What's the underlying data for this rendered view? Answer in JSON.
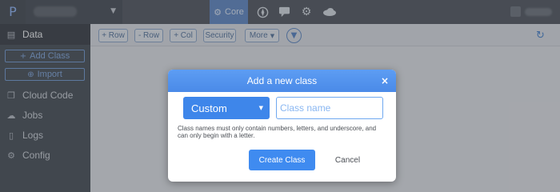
{
  "topbar": {
    "logo_glyph": "P",
    "app_caret": "▼",
    "nav": {
      "core_label": "Core",
      "core_icon": "gear-cluster-icon",
      "icons": [
        "compass-icon",
        "chat-icon",
        "gear-icon",
        "cloud-icon"
      ]
    }
  },
  "sidebar": {
    "items": [
      {
        "label": "Data",
        "icon": "database-icon",
        "active": true
      },
      {
        "label": "Cloud Code",
        "icon": "code-icon"
      },
      {
        "label": "Jobs",
        "icon": "cloud-upload-icon"
      },
      {
        "label": "Logs",
        "icon": "document-icon"
      },
      {
        "label": "Config",
        "icon": "gears-icon"
      }
    ],
    "add_class_label": "Add Class",
    "import_label": "Import"
  },
  "toolbar": {
    "buttons": [
      "+ Row",
      "- Row",
      "+ Col",
      "Security"
    ],
    "more_label": "More",
    "more_caret": "▼"
  },
  "modal": {
    "title": "Add a new class",
    "close_glyph": "×",
    "type_value": "Custom",
    "type_caret": "▼",
    "name_placeholder": "Class name",
    "helper_text": "Class names must only contain numbers, letters, and underscore, and can only begin with a letter.",
    "create_label": "Create Class",
    "cancel_label": "Cancel"
  },
  "colors": {
    "accent": "#3f8bf0",
    "topbar": "#4a4f57",
    "sidebar": "#3f454d",
    "core_nav": "#5a86c6"
  }
}
